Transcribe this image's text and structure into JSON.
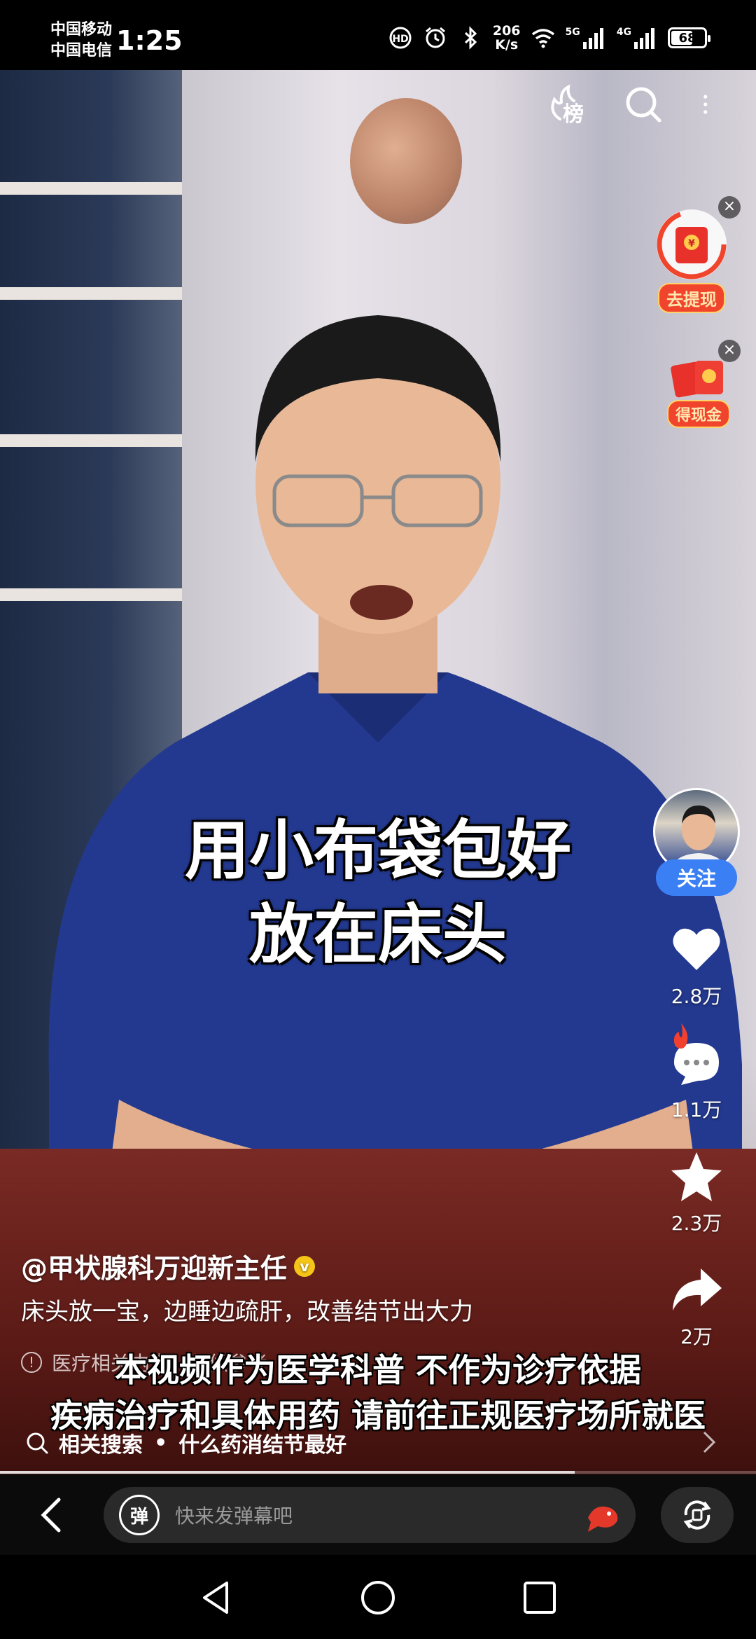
{
  "status_bar": {
    "carrier1": "中国移动",
    "carrier2": "中国电信",
    "time": "1:25",
    "speed_value": "206",
    "speed_unit": "K/s",
    "network1": "5G",
    "network2": "4G",
    "battery": "68",
    "battery_level_percent": 68
  },
  "top_icons": [
    "ranking-icon",
    "search-icon",
    "more-icon"
  ],
  "top_icons_label": {
    "ranking": "榜"
  },
  "rewards": {
    "withdraw_label": "去提现",
    "cash_label": "得现金",
    "close": "×"
  },
  "video": {
    "caption_line1": "用小布袋包好",
    "caption_line2": "放在床头"
  },
  "actions": {
    "follow_label": "关注",
    "likes": "2.8万",
    "comments": "1.1万",
    "favorites": "2.3万",
    "shares": "2万"
  },
  "post": {
    "author": "@甲状腺科万迎新主任",
    "verified_mark": "v",
    "description": "床头放一宝，边睡边疏肝，改善结节出大力",
    "notice_icon": "!",
    "notice_text": "医疗相关内容，仅供参考"
  },
  "disclaimer": {
    "line1": "本视频作为医学科普 不作为诊疗依据",
    "line2": "疾病治疗和具体用药 请前往正规医疗场所就医"
  },
  "related_search": {
    "label": "相关搜索",
    "separator": "•",
    "query": "什么药消结节最好"
  },
  "bottom_bar": {
    "danmu_badge": "弹",
    "danmu_placeholder": "快来发弹幕吧"
  },
  "colors": {
    "accent_blue": "#3b7ff5",
    "reward_red": "#f0442c",
    "verified_gold": "#f5c518"
  }
}
